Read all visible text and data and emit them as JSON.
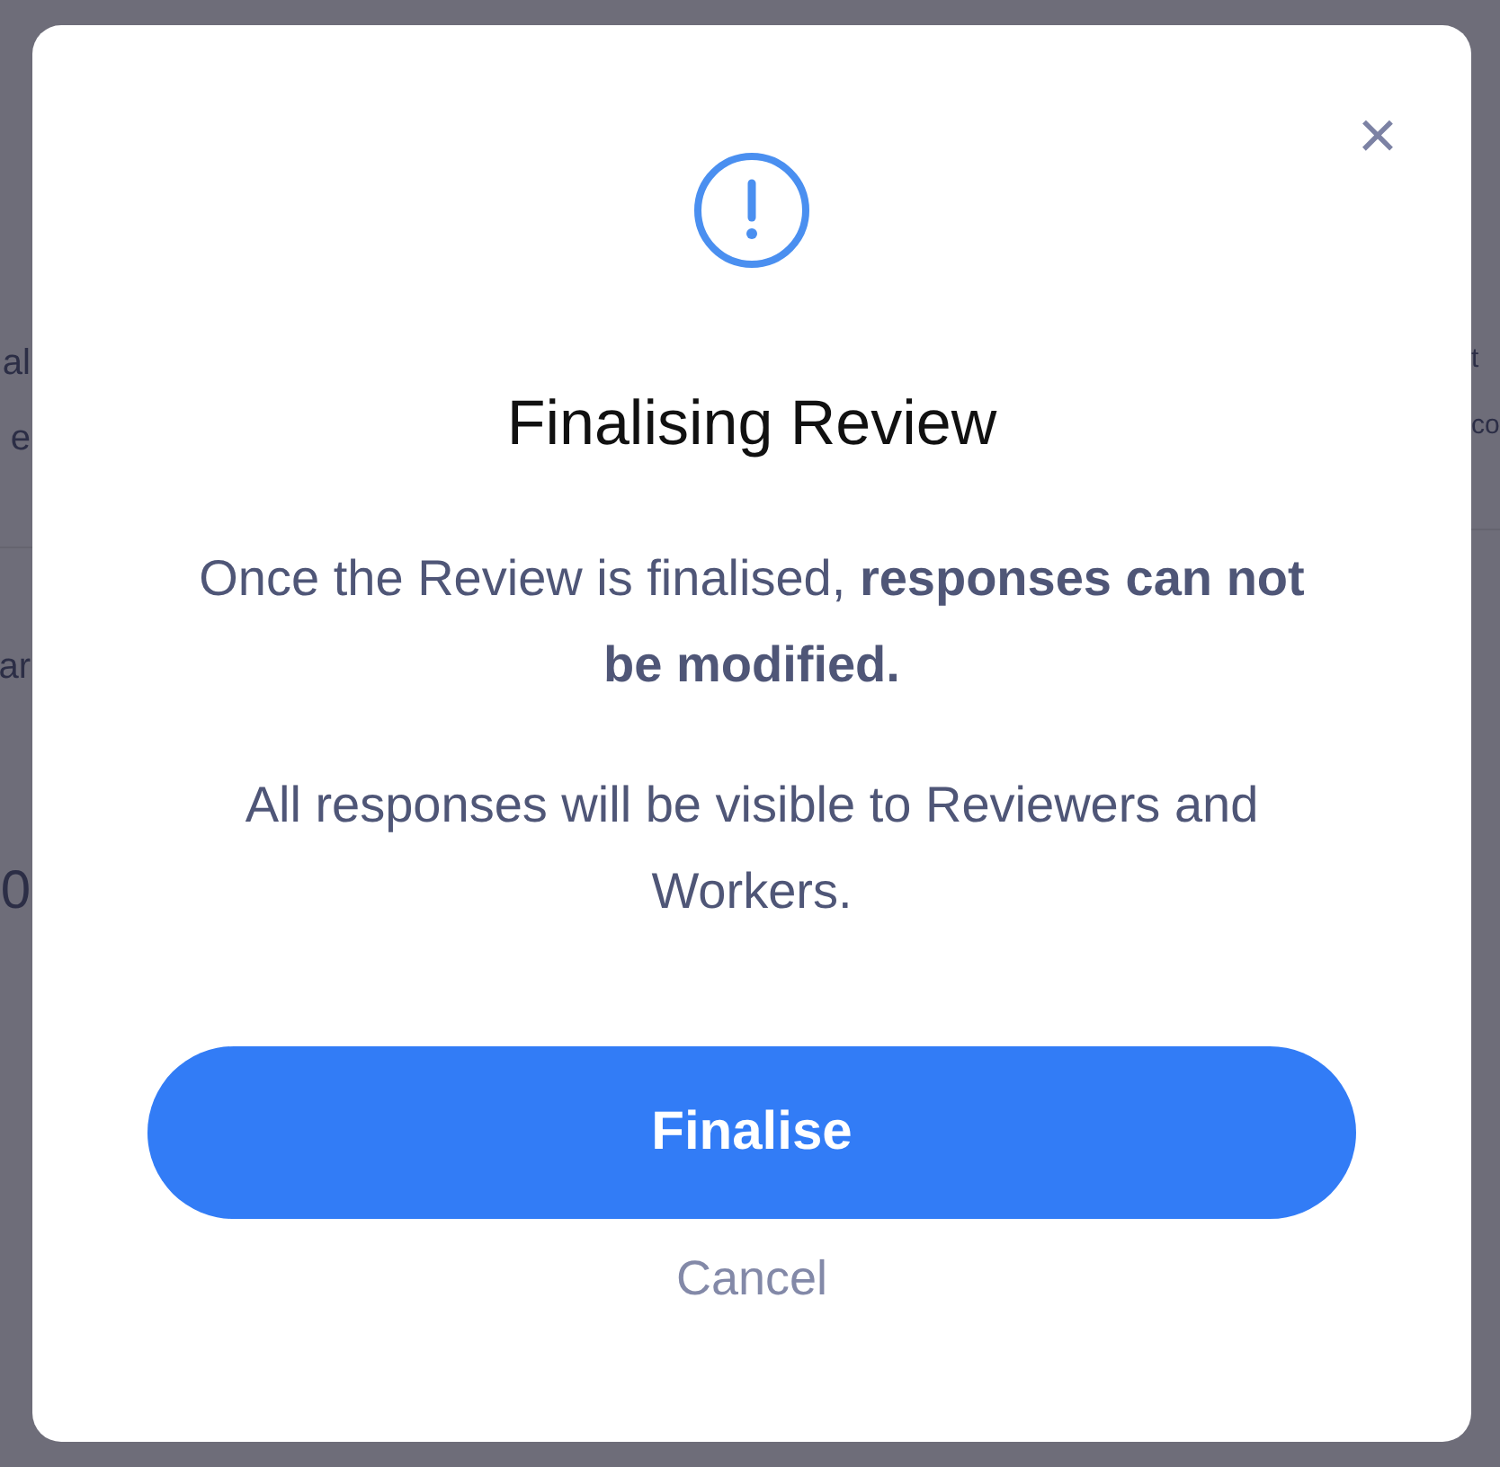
{
  "background": {
    "left_fragments": [
      {
        "text": "al",
        "kind": "line"
      },
      {
        "text": "e",
        "kind": "line"
      },
      {
        "text": "ar",
        "kind": "label"
      },
      {
        "text": "0",
        "kind": "figure"
      }
    ],
    "right_fragments": [
      {
        "text": "t",
        "kind": "line"
      },
      {
        "text": "co",
        "kind": "line"
      }
    ]
  },
  "dialog": {
    "close": "×",
    "title": "Finalising Review",
    "paragraphs": [
      "Once the Review is finalised, **responses can not be modified.**",
      "All responses will be visible to Reviewers and Workers."
    ],
    "primary_button": "Finalise",
    "secondary_button": "Cancel"
  }
}
